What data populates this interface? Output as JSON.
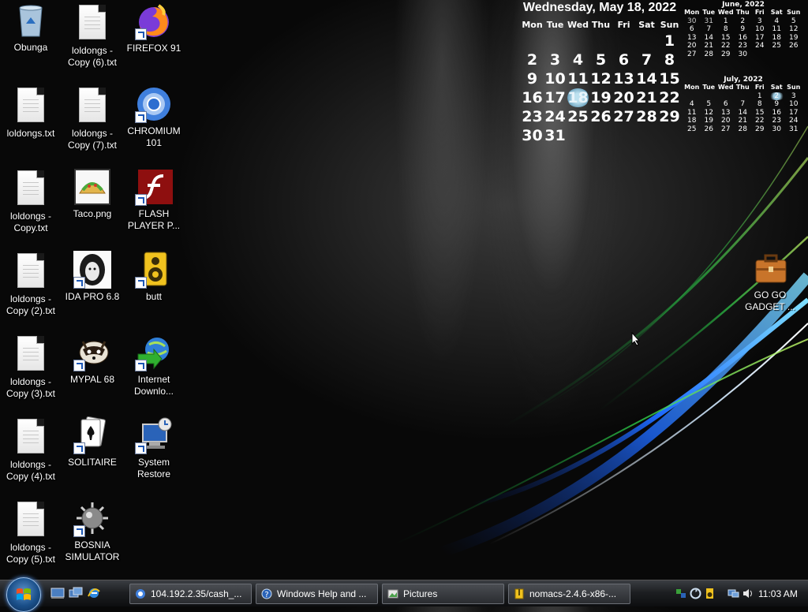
{
  "desktop": {
    "icons": [
      {
        "label": "Obunga"
      },
      {
        "label": "loldongs - Copy (6).txt"
      },
      {
        "label": "FIREFOX 91"
      },
      {
        "label": "loldongs.txt"
      },
      {
        "label": "loldongs - Copy (7).txt"
      },
      {
        "label": "CHROMIUM 101"
      },
      {
        "label": "loldongs - Copy.txt"
      },
      {
        "label": "Taco.png"
      },
      {
        "label": "FLASH PLAYER P..."
      },
      {
        "label": "loldongs - Copy (2).txt"
      },
      {
        "label": "IDA PRO 6.8"
      },
      {
        "label": "butt"
      },
      {
        "label": "loldongs - Copy (3).txt"
      },
      {
        "label": "MYPAL 68"
      },
      {
        "label": "Internet Downlo..."
      },
      {
        "label": "loldongs - Copy (4).txt"
      },
      {
        "label": "SOLITAIRE"
      },
      {
        "label": "System Restore"
      },
      {
        "label": "loldongs - Copy (5).txt"
      },
      {
        "label": "BOSNIA SIMULATOR"
      },
      {
        "label": "GO GO GADGET ..."
      }
    ]
  },
  "calendar": {
    "header": "Wednesday, May 18, 2022",
    "weekdays": [
      "Mon",
      "Tue",
      "Wed",
      "Thu",
      "Fri",
      "Sat",
      "Sun"
    ],
    "days": [
      "",
      "",
      "",
      "",
      "",
      "",
      "1",
      "2",
      "3",
      "4",
      "5",
      "6",
      "7",
      "8",
      "9",
      "10",
      "11",
      "12",
      "13",
      "14",
      "15",
      "16",
      "17",
      "18",
      "19",
      "20",
      "21",
      "22",
      "23",
      "24",
      "25",
      "26",
      "27",
      "28",
      "29",
      "30",
      "31"
    ],
    "today": "18",
    "june": {
      "title": "June, 2022",
      "weekdays": [
        "Mon",
        "Tue",
        "Wed",
        "Thu",
        "Fri",
        "Sat",
        "Sun"
      ],
      "cells": [
        "30",
        "31",
        "1",
        "2",
        "3",
        "4",
        "5",
        "6",
        "7",
        "8",
        "9",
        "10",
        "11",
        "12",
        "13",
        "14",
        "15",
        "16",
        "17",
        "18",
        "19",
        "20",
        "21",
        "22",
        "23",
        "24",
        "25",
        "26",
        "27",
        "28",
        "29",
        "30",
        "",
        "",
        "",
        ""
      ]
    },
    "july": {
      "title": "July, 2022",
      "weekdays": [
        "Mon",
        "Tue",
        "Wed",
        "Thu",
        "Fri",
        "Sat",
        "Sun"
      ],
      "cells": [
        "",
        "",
        "",
        "",
        "1",
        "2",
        "3",
        "4",
        "5",
        "6",
        "7",
        "8",
        "9",
        "10",
        "11",
        "12",
        "13",
        "14",
        "15",
        "16",
        "17",
        "18",
        "19",
        "20",
        "21",
        "22",
        "23",
        "24",
        "25",
        "26",
        "27",
        "28",
        "29",
        "30",
        "31"
      ]
    }
  },
  "taskbar": {
    "tasks": [
      {
        "label": "104.192.2.35/cash_..."
      },
      {
        "label": "Windows Help and ..."
      },
      {
        "label": "Pictures"
      },
      {
        "label": "nomacs-2.4.6-x86-..."
      }
    ],
    "clock": "11:03 AM"
  },
  "colors": {
    "accent": "#1c57b6",
    "taskbar": "#1d1f22"
  }
}
